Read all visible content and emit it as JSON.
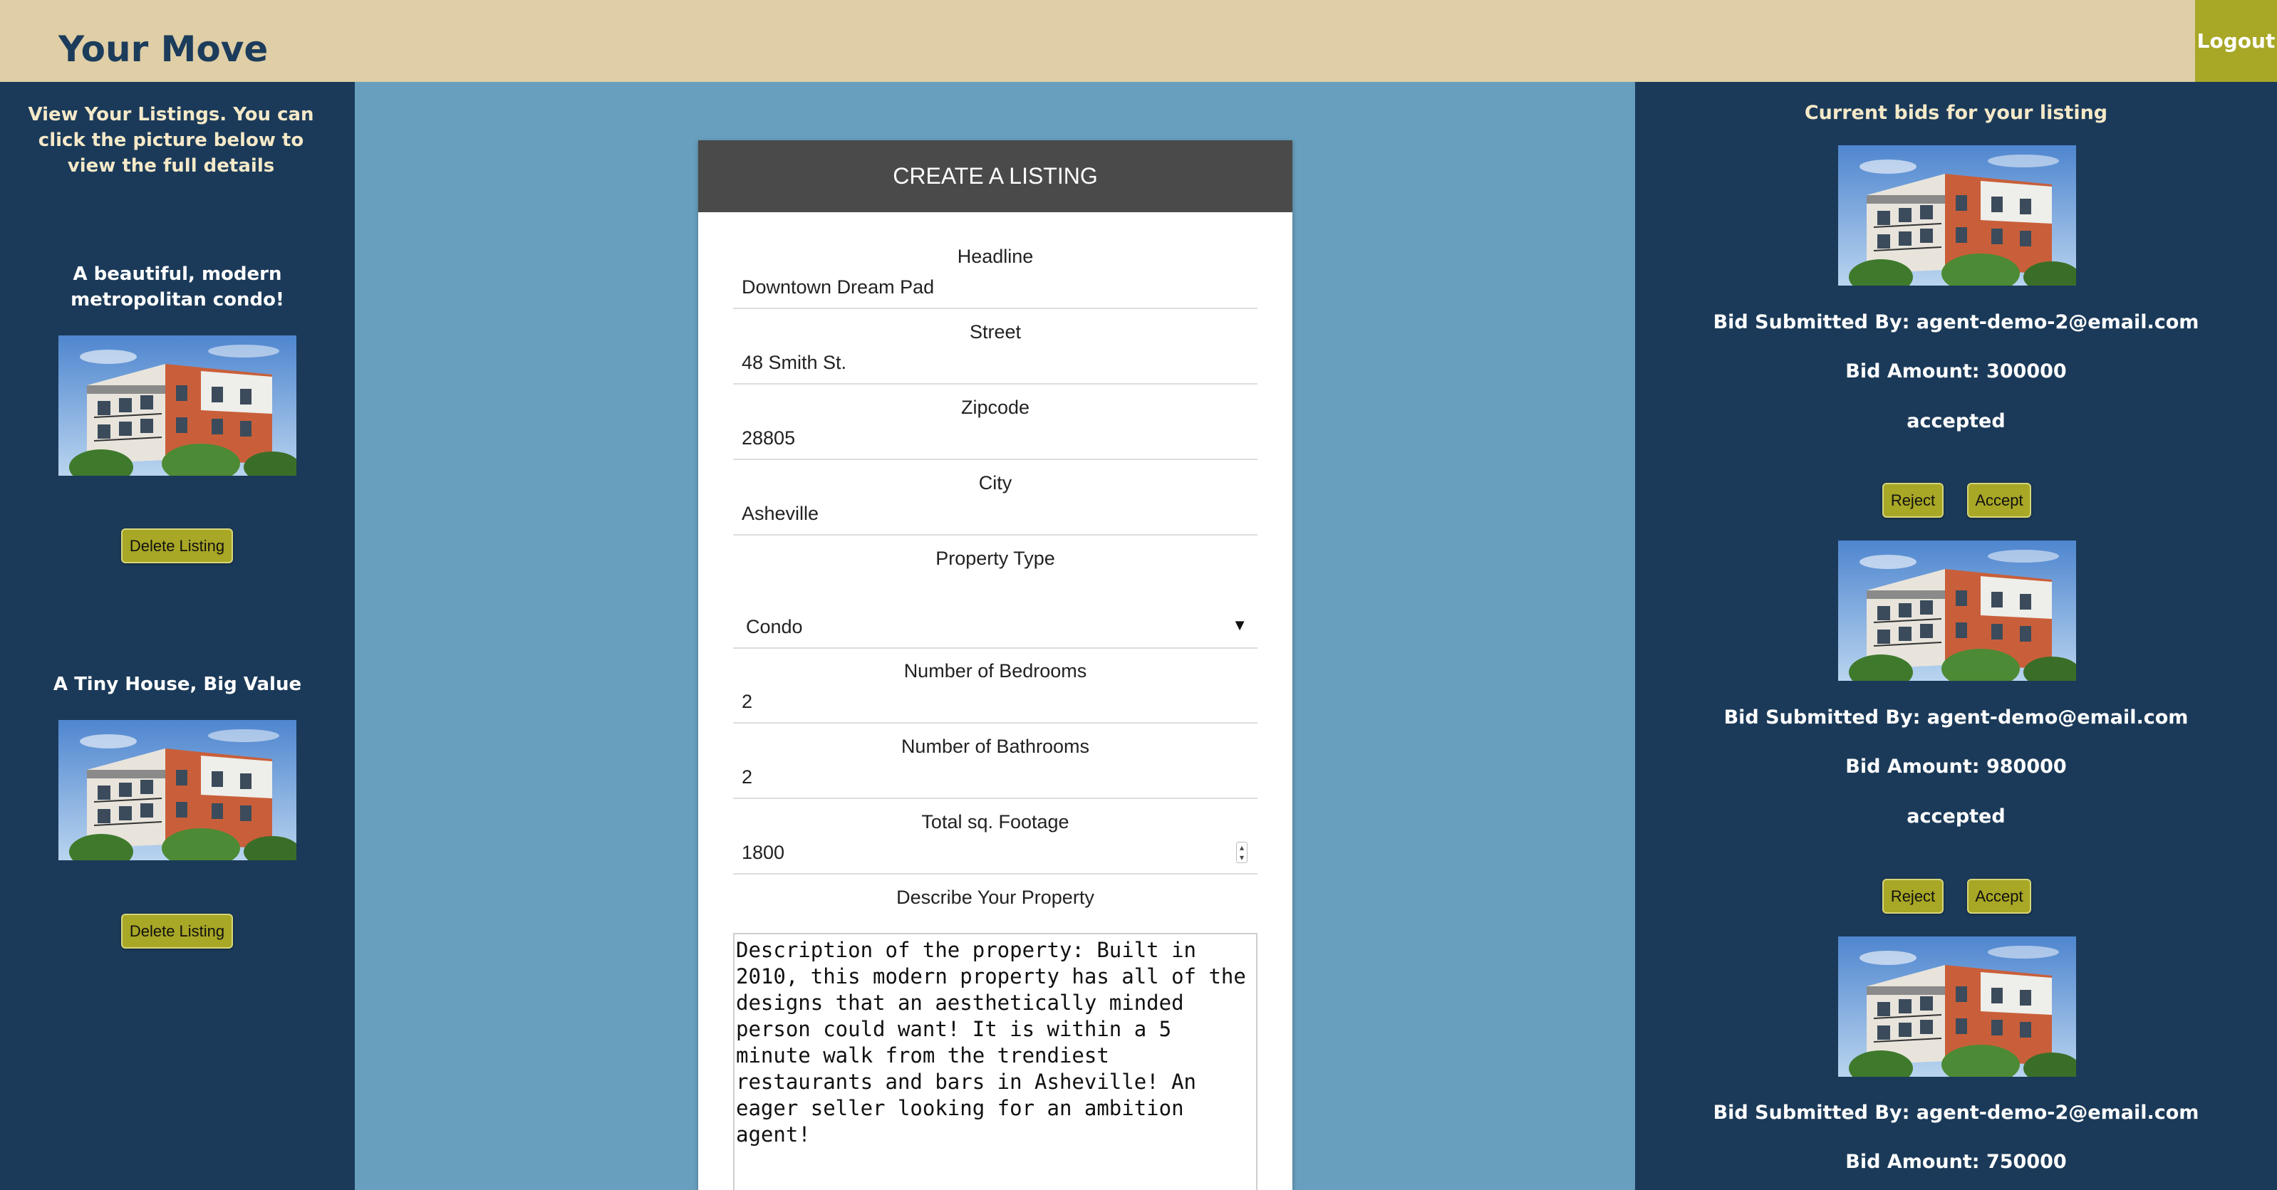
{
  "header": {
    "title": "Your Move",
    "logout_label": "Logout",
    "bg_color": "#dfcea6",
    "accent_color": "#a8a726"
  },
  "left_panel": {
    "intro": "View Your Listings. You can click the picture below to view the full details",
    "listings": [
      {
        "title": "A beautiful, modern metropolitan condo!",
        "delete_label": "Delete Listing"
      },
      {
        "title": "A Tiny House, Big Value",
        "delete_label": "Delete Listing"
      }
    ]
  },
  "form": {
    "heading": "CREATE A LISTING",
    "fields": {
      "headline": {
        "label": "Headline",
        "value": "Downtown Dream Pad"
      },
      "street": {
        "label": "Street",
        "value": "48 Smith St."
      },
      "zipcode": {
        "label": "Zipcode",
        "value": "28805"
      },
      "city": {
        "label": "City",
        "value": "Asheville"
      },
      "property_type": {
        "label": "Property Type",
        "value": "Condo"
      },
      "bedrooms": {
        "label": "Number of Bedrooms",
        "value": "2"
      },
      "bathrooms": {
        "label": "Number of Bathrooms",
        "value": "2"
      },
      "sqft": {
        "label": "Total sq. Footage",
        "value": "1800"
      },
      "description": {
        "label": "Describe Your Property",
        "value": "Description of the property: Built in 2010, this modern property has all of the designs that an aesthetically minded person could want! It is within a 5 minute walk from the trendiest restaurants and bars in Asheville! An eager seller looking for an ambition agent!"
      }
    }
  },
  "right_panel": {
    "title": "Current bids for your listing",
    "bids": [
      {
        "submitted_by": "Bid Submitted By: agent-demo-2@email.com",
        "amount": "Bid Amount: 300000",
        "status": "accepted",
        "reject_label": "Reject",
        "accept_label": "Accept"
      },
      {
        "submitted_by": "Bid Submitted By: agent-demo@email.com",
        "amount": "Bid Amount: 980000",
        "status": "accepted",
        "reject_label": "Reject",
        "accept_label": "Accept"
      },
      {
        "submitted_by": "Bid Submitted By: agent-demo-2@email.com",
        "amount": "Bid Amount: 750000"
      }
    ]
  }
}
